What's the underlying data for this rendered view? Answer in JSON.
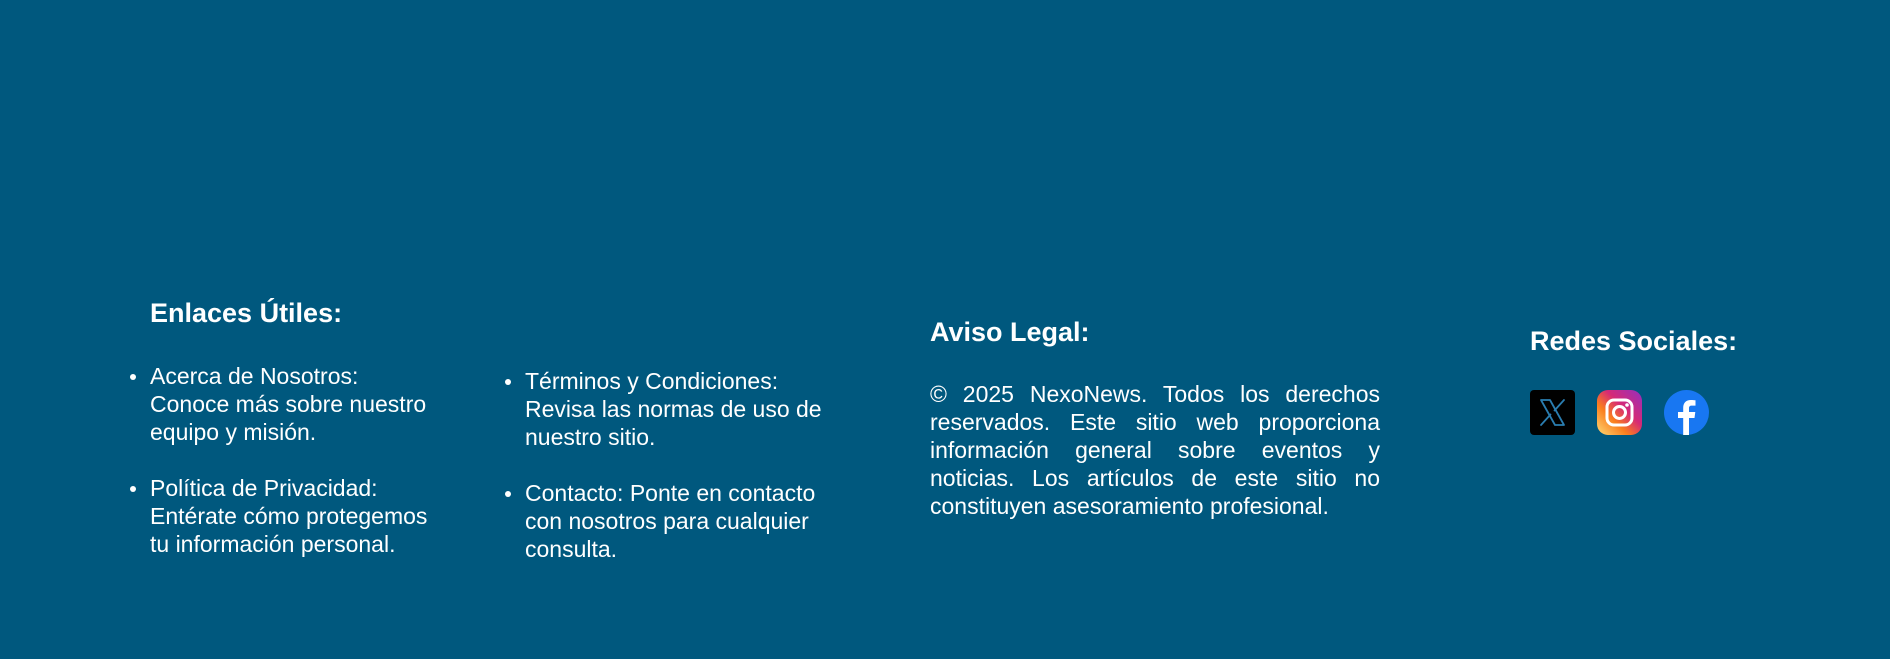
{
  "links": {
    "title": "Enlaces Útiles:",
    "column1": [
      {
        "text": "Acerca de Nosotros: Conoce más sobre nuestro equipo y misión."
      },
      {
        "text": "Política de Privacidad: Entérate cómo protegemos tu información personal."
      }
    ],
    "column2": [
      {
        "text": "Términos y Condiciones: Revisa las normas de uso de nuestro sitio."
      },
      {
        "text": "Contacto: Ponte en contacto con nosotros para cualquier consulta."
      }
    ]
  },
  "legal": {
    "title": "Aviso Legal:",
    "text": "© 2025 NexoNews. Todos los derechos reservados. Este sitio web proporciona información general sobre eventos y noticias. Los artículos de este sitio no constituyen asesoramiento profesional."
  },
  "social": {
    "title": "Redes Sociales:",
    "icons": [
      "x-icon",
      "instagram-icon",
      "facebook-icon"
    ]
  },
  "colors": {
    "background": "#00587e",
    "text": "#ffffff",
    "x_icon_bg": "#000000",
    "facebook_blue": "#1877f2"
  }
}
